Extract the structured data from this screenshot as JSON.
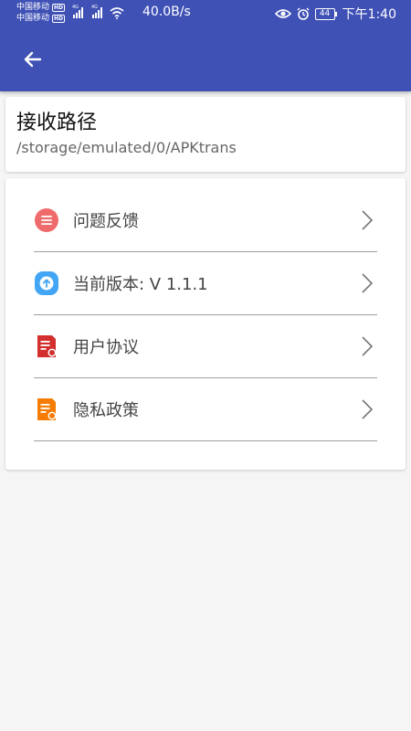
{
  "status_bar": {
    "carrier1": "中国移动",
    "carrier2": "中国移动",
    "hd_badge": "HD",
    "network_tag": "4G",
    "net_speed": "40.0B/s",
    "battery_level": "44",
    "time": "下午1:40"
  },
  "appbar": {
    "back_icon": "arrow-left-icon"
  },
  "path_card": {
    "title": "接收路径",
    "path": "/storage/emulated/0/APKtrans"
  },
  "menu": {
    "items": [
      {
        "label": "问题反馈",
        "icon": "feedback-icon"
      },
      {
        "label": "当前版本:  V 1.1.1",
        "icon": "version-upload-icon"
      },
      {
        "label": "用户协议",
        "icon": "user-agreement-icon"
      },
      {
        "label": "隐私政策",
        "icon": "privacy-policy-icon"
      }
    ]
  },
  "colors": {
    "primary": "#3f51b5",
    "feedback": "#ef6b6b",
    "version": "#42a5f5",
    "agreement": "#d32f2f",
    "privacy": "#f57c00"
  }
}
